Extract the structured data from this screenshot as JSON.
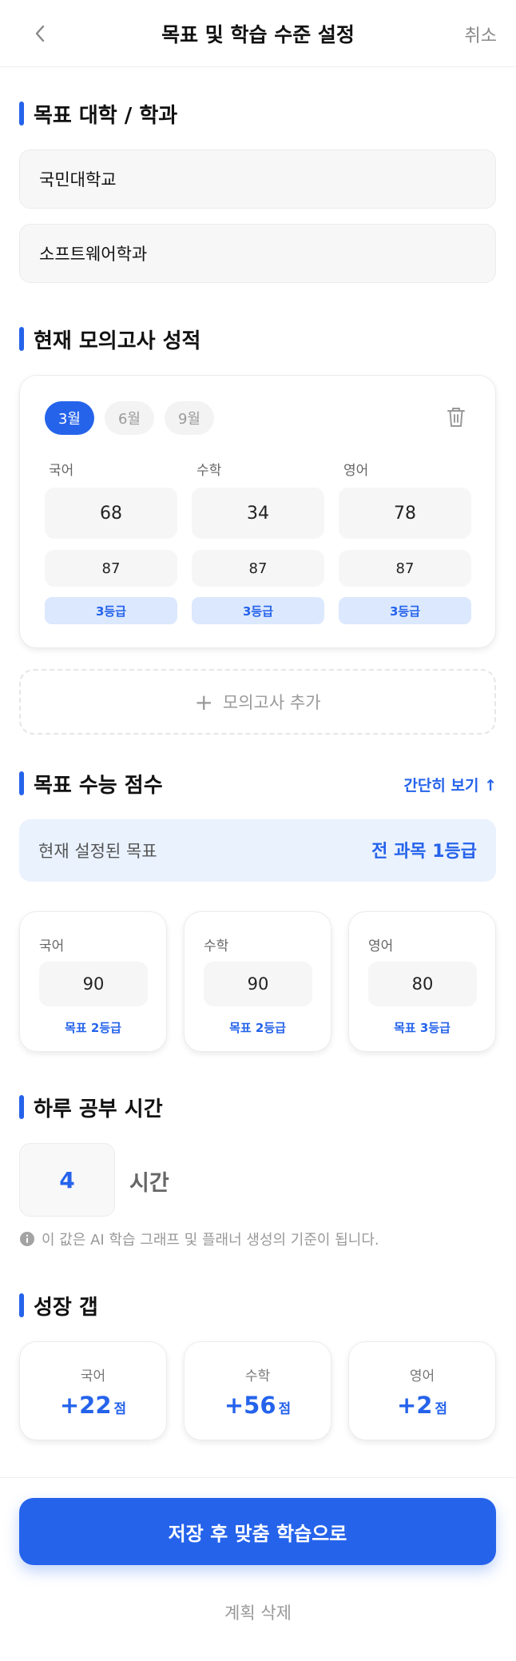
{
  "header": {
    "title": "목표 및 학습 수준 설정",
    "cancel_label": "취소"
  },
  "target": {
    "section_title": "목표 대학 / 학과",
    "university": "국민대학교",
    "department": "소프트웨어학과"
  },
  "mock": {
    "section_title": "현재 모의고사 성적",
    "months": [
      "3월",
      "6월",
      "9월"
    ],
    "selected_month": "3월",
    "subjects": [
      {
        "name": "국어",
        "score": "68",
        "percentile": "87",
        "grade": "3등급"
      },
      {
        "name": "수학",
        "score": "34",
        "percentile": "87",
        "grade": "3등급"
      },
      {
        "name": "영어",
        "score": "78",
        "percentile": "87",
        "grade": "3등급"
      }
    ],
    "add_label": "모의고사 추가"
  },
  "goal": {
    "section_title": "목표 수능 점수",
    "simple_view_label": "간단히 보기 ↑",
    "current_label": "현재 설정된 목표",
    "current_value": "전 과목 1등급",
    "subjects": [
      {
        "name": "국어",
        "score": "90",
        "grade": "목표 2등급"
      },
      {
        "name": "수학",
        "score": "90",
        "grade": "목표 2등급"
      },
      {
        "name": "영어",
        "score": "80",
        "grade": "목표 3등급"
      }
    ]
  },
  "study": {
    "section_title": "하루 공부 시간",
    "hours": "4",
    "unit": "시간",
    "info": "이 값은 AI 학습 그래프 및 플래너 생성의 기준이 됩니다."
  },
  "gap": {
    "section_title": "성장 갭",
    "items": [
      {
        "name": "국어",
        "value": "+22",
        "unit": "점"
      },
      {
        "name": "수학",
        "value": "+56",
        "unit": "점"
      },
      {
        "name": "영어",
        "value": "+2",
        "unit": "점"
      }
    ]
  },
  "footer": {
    "save_label": "저장 후 맞춤 학습으로",
    "delete_label": "계획 삭제"
  },
  "colors": {
    "accent": "#2563eb",
    "chip_bg": "#dbe8fd",
    "banner_bg": "#eaf2fe"
  }
}
